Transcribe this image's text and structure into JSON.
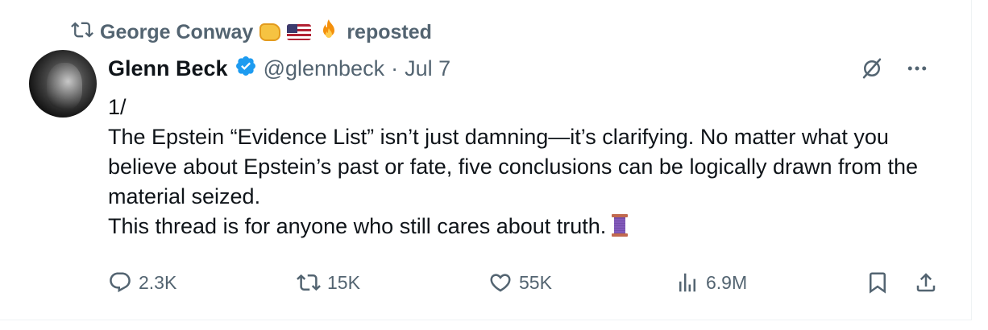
{
  "repost": {
    "user": "George Conway",
    "emojis": [
      "oncoming-fist",
      "us-flag",
      "fire"
    ],
    "label": "reposted"
  },
  "tweet": {
    "author_name": "Glenn Beck",
    "handle": "@glennbeck",
    "separator": "·",
    "date": "Jul 7",
    "text": "1/\nThe Epstein “Evidence List” isn’t just damning—it’s clarifying. No matter what you believe about Epstein’s past or fate, five conclusions can be logically drawn from the material seized.\nThis thread is for anyone who still cares about truth.",
    "trailing_emoji": "thread-icon"
  },
  "stats": {
    "replies": "2.3K",
    "reposts": "15K",
    "likes": "55K",
    "views": "6.9M"
  },
  "colors": {
    "text": "#0f1419",
    "muted": "#536471",
    "verified": "#1d9bf0"
  }
}
